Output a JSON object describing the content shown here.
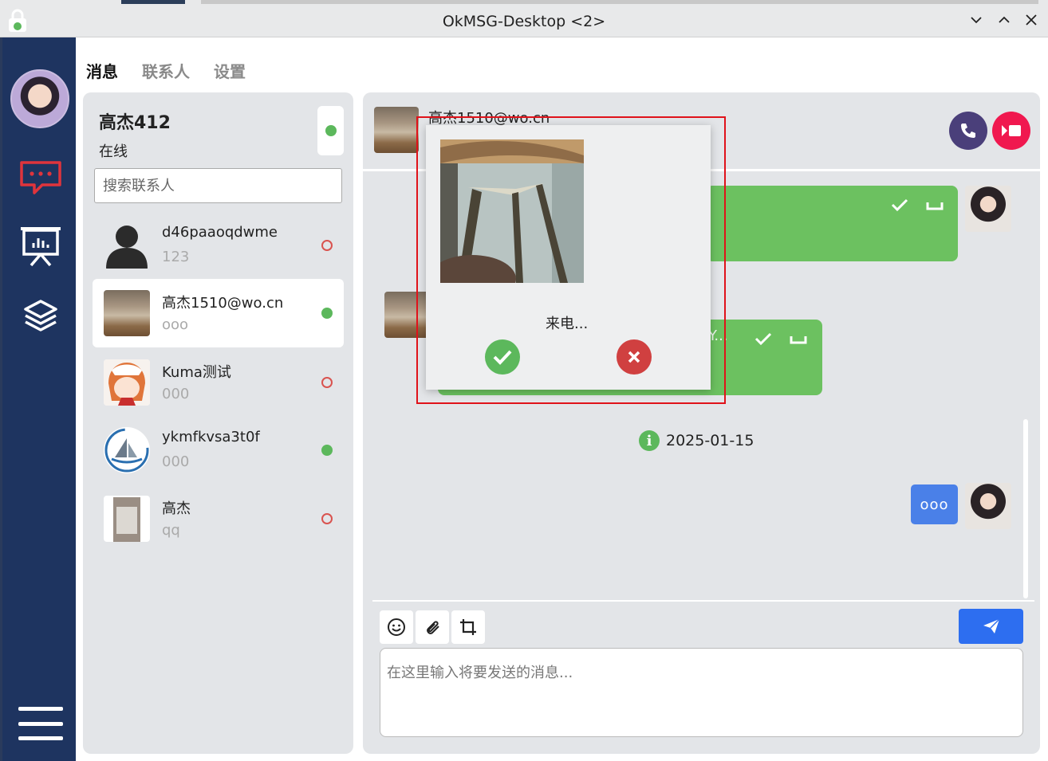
{
  "window": {
    "title": "OkMSG-Desktop <2>"
  },
  "tabs": [
    {
      "label": "消息"
    },
    {
      "label": "联系人"
    },
    {
      "label": "设置"
    }
  ],
  "me": {
    "name": "高杰412",
    "status": "在线"
  },
  "search": {
    "placeholder": "搜索联系人"
  },
  "contacts": [
    {
      "name": "d46paaoqdwme",
      "sub": "123",
      "online": false
    },
    {
      "name": "高杰1510@wo.cn",
      "sub": "ooo",
      "online": true,
      "selected": true
    },
    {
      "name": "Kuma测试",
      "sub": "000",
      "online": false
    },
    {
      "name": "ykmfkvsa3t0f",
      "sub": "000",
      "online": true
    },
    {
      "name": "高杰",
      "sub": "qq",
      "online": false
    }
  ],
  "chat": {
    "header_name": "高杰1510@wo.cn",
    "partial_text": "Y...",
    "date_separator": "2025-01-15",
    "blue_message": "ooo",
    "input_placeholder": "在这里输入将要发送的消息..."
  },
  "incoming_call": {
    "text": "来电..."
  },
  "colors": {
    "sidebar": "#1e3460",
    "panel": "#e3e5e8",
    "online": "#5cb85c",
    "offline": "#d9534f",
    "bubble_green": "#6cc160",
    "bubble_blue": "#4a80e8",
    "send_button": "#2d6ef0",
    "voice_call": "#4a3f7a",
    "video_call": "#f0184f",
    "highlight_frame": "#e0121a"
  },
  "icons": {
    "sidebar": [
      "chat-icon",
      "presentation-icon",
      "layers-icon",
      "menu-icon"
    ],
    "toolbar": [
      "emoji-icon",
      "paperclip-icon",
      "crop-icon",
      "send-icon"
    ],
    "chat_header": [
      "phone-icon",
      "video-icon"
    ],
    "call": [
      "accept-icon",
      "reject-icon"
    ]
  }
}
